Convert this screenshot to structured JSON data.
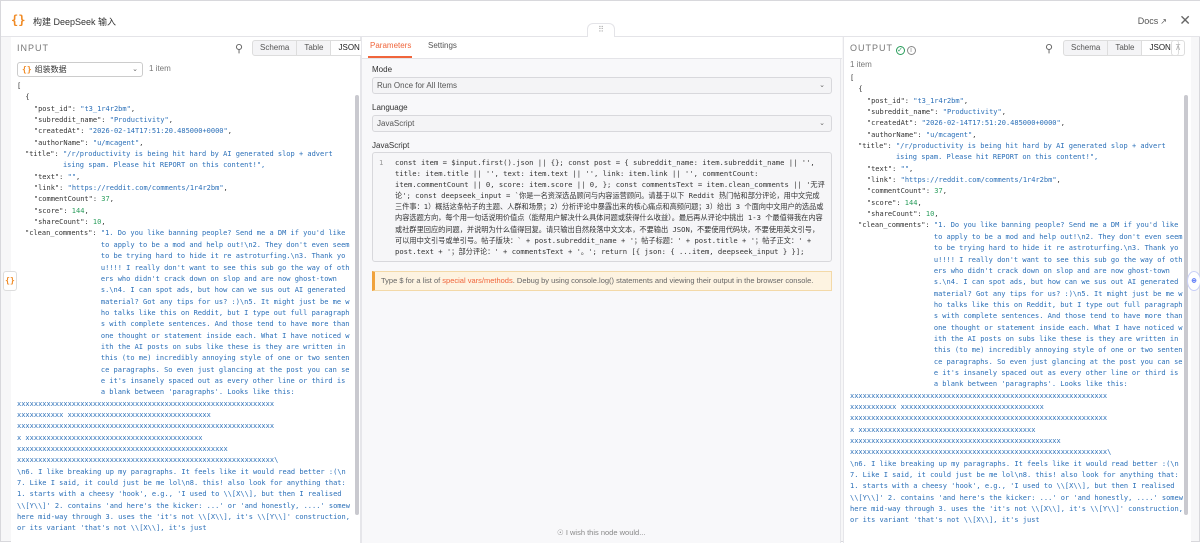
{
  "header": {
    "title": "构建 DeepSeek 输入",
    "docs_label": "Docs",
    "close_label": "✕"
  },
  "input_panel": {
    "label": "INPUT",
    "views": [
      "Schema",
      "Table",
      "JSON"
    ],
    "active_view": "JSON",
    "source_select": "组装数据",
    "item_count": "1 item"
  },
  "output_panel": {
    "label": "OUTPUT",
    "views": [
      "Schema",
      "Table",
      "JSON"
    ],
    "active_view": "JSON",
    "item_count": "1 item"
  },
  "json_record": {
    "post_id": "t3_1r4r2bm",
    "subreddit_name": "Productivity",
    "createdAt": "2026-02-14T17:51:20.485000+0000",
    "authorName": "u/mcagent",
    "title": "/r/productivity is being hit hard by AI generated slop + advertising spam. Please hit REPORT on this content!",
    "text": "",
    "link": "https://reddit.com/comments/1r4r2bm",
    "commentCount": "37",
    "score": "144",
    "shareCount": "10",
    "clean_comments": "1. Do you like banning people? Send me a DM if you'd like to apply to be a mod and help out!\\n2. They don't even seem to be trying hard to hide it re astroturfing.\\n3. Thank you!!!! I really don't want to see this sub go the way of others who didn't crack down on slop and are now ghost-towns.\\n4. I can spot ads, but how can we sus out AI generated material? Got any tips for us? :)\\n5. It might just be me who talks like this on Reddit, but I type out full paragraphs with complete sentences. And those tend to have more than one thought or statement inside each. What I have noticed with the AI posts on subs like these is they are written in this (to me) incredibly annoying style of one or two sentence paragraphs. So even just glancing at the post you can see it's insanely spaced out as every other line or third is a blank between 'paragraphs'. Looks like this:",
    "xblock_1": "xxxxxxxxxxxxxxxxxxxxxxxxxxxxxxxxxxxxxxxxxxxxxxxxxxxxxxxxxxxxx",
    "xblock_2": "xxxxxxxxxxx  xxxxxxxxxxxxxxxxxxxxxxxxxxxxxxxxxx",
    "xblock_3": "xxxxxxxxxxxxxxxxxxxxxxxxxxxxxxxxxxxxxxxxxxxxxxxxxxxxxxxxxxxxx",
    "xblock_4": "x  xxxxxxxxxxxxxxxxxxxxxxxxxxxxxxxxxxxxxxxxxx",
    "xblock_5": "xxxxxxxxxxxxxxxxxxxxxxxxxxxxxxxxxxxxxxxxxxxxxxxxxx",
    "xblock_6": "xxxxxxxxxxxxxxxxxxxxxxxxxxxxxxxxxxxxxxxxxxxxxxxxxxxxxxxxxxxxx\\",
    "tail": "\\n6. I like breaking up my paragraphs. It feels like it would read better :(\\n7. Like I said, it could just be me lol\\n8. this! also look for anything that:  1. starts with a cheesy 'hook', e.g., 'I used to \\\\[X\\\\], but then I realised \\\\[Y\\\\]'  2. contains 'and here's the kicker: ...' or 'and honestly, ....' somewhere mid-way through  3. uses the 'it's not \\\\[X\\\\], it's \\\\[Y\\\\]' construction, or its variant 'that's not \\\\[X\\\\], it's just"
  },
  "params": {
    "tabs": [
      "Parameters",
      "Settings"
    ],
    "active_tab": "Parameters",
    "mode_label": "Mode",
    "mode_value": "Run Once for All Items",
    "language_label": "Language",
    "language_value": "JavaScript",
    "code_label": "JavaScript",
    "line_number": "1",
    "code": "const item = $input.first().json || {}; const post = { subreddit_name: item.subreddit_name || '', title: item.title || '', text: item.text || '', link: item.link || '', commentCount: item.commentCount || 0, score: item.score || 0, }; const commentsText = item.clean_comments || '无评论'; const deepseek_input = `你是一名资深选品顾问与内容运营顾问。请基于以下 Reddit 热门帖和部分评论，用中文完成三件事：1）概括这条帖子的主题、人群和场景；2）分析评论中暴露出来的核心痛点和高频问题；3）给出 3 个面向中文用户的选品或内容选题方向，每个用一句话说明价值点（能帮用户解决什么具体问题或获得什么收益）。最后再从评论中挑出 1-3 个最值得我在内容或社群里回应的问题，并说明为什么值得回复。请只输出自然段落中文文本，不要输出 JSON，不要使用代码块，不要使用英文引号，可以用中文引号或单引号。帖子版块：` + post.subreddit_name + '；帖子标题：' + post.title + '；帖子正文：' + post.text + '；部分评论：' + commentsText + '。'; return [{ json: { ...item, deepseek_input } }];",
    "hint_prefix": "Type $ for a list of ",
    "hint_link": "special vars/methods",
    "hint_suffix": ". Debug by using console.log() statements and viewing their output in the browser console.",
    "wish": "I wish this node would..."
  }
}
